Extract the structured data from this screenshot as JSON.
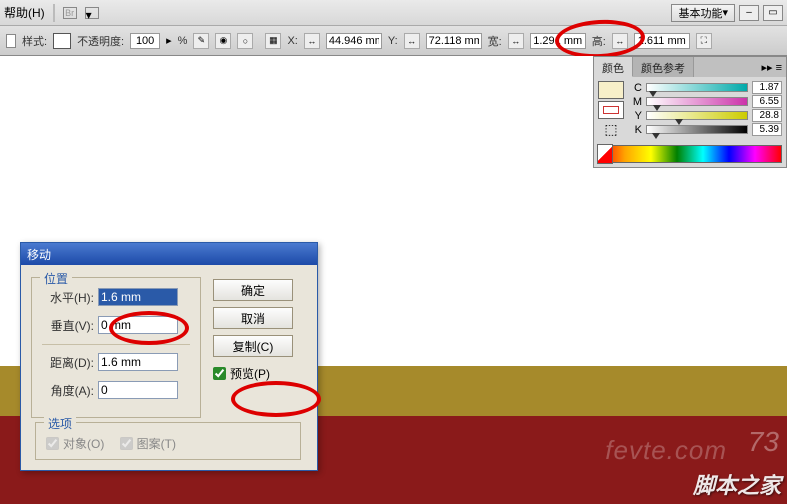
{
  "menubar": {
    "help": "帮助(H)",
    "mode": "基本功能"
  },
  "optbar": {
    "style": "样式:",
    "opacity_label": "不透明度:",
    "opacity_value": "100",
    "pct": "%",
    "x_label": "X:",
    "x_value": "44.946 mm",
    "y_label": "Y:",
    "y_value": "72.118 mm",
    "w_label": "宽:",
    "w_value": "1.291 mm",
    "h_label": "高:",
    "h_value": "1.611 mm"
  },
  "colorpanel": {
    "tab_color": "颜色",
    "tab_guide": "颜色参考",
    "channels": [
      {
        "name": "C",
        "value": "1.87"
      },
      {
        "name": "M",
        "value": "6.55"
      },
      {
        "name": "Y",
        "value": "28.8"
      },
      {
        "name": "K",
        "value": "5.39"
      }
    ]
  },
  "dialog": {
    "title": "移动",
    "pos_legend": "位置",
    "horiz_label": "水平(H):",
    "horiz_value": "1.6 mm",
    "vert_label": "垂直(V):",
    "vert_value": "0 mm",
    "dist_label": "距离(D):",
    "dist_value": "1.6 mm",
    "angle_label": "角度(A):",
    "angle_value": "0",
    "ok": "确定",
    "cancel": "取消",
    "copy": "复制(C)",
    "preview": "预览(P)",
    "opts_legend": "选项",
    "opt_obj": "对象(O)",
    "opt_pat": "图案(T)"
  },
  "watermark": {
    "main": "脚本之家",
    "sub": "fevte.com",
    "num": "73"
  }
}
